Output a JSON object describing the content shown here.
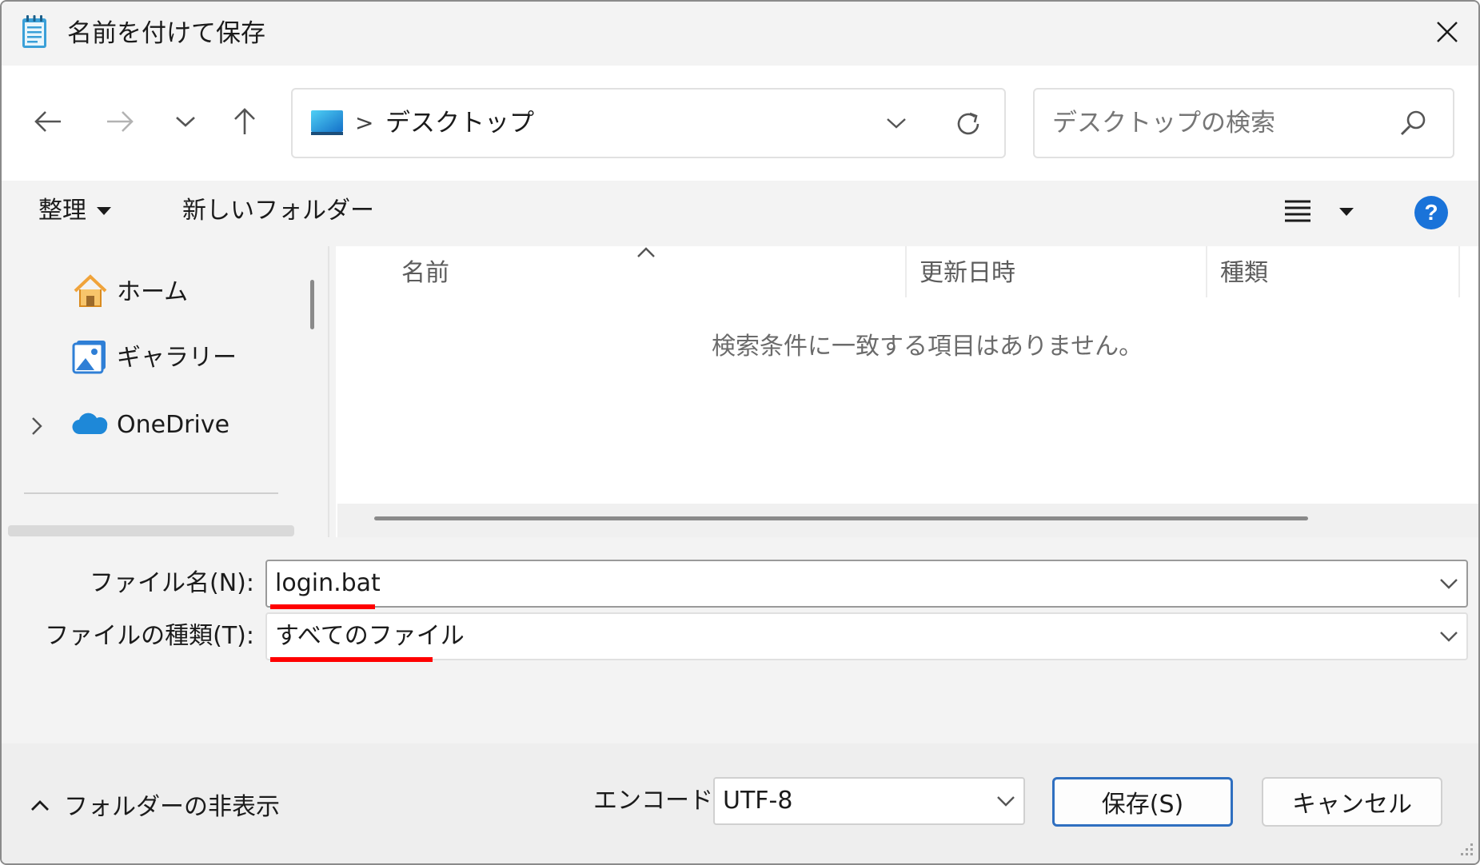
{
  "window": {
    "title": "名前を付けて保存"
  },
  "icons": {
    "app": "notepad-icon",
    "close": "close-icon",
    "back": "back-arrow-icon",
    "forward": "forward-arrow-icon",
    "recent": "chevron-down-icon",
    "up": "up-arrow-icon",
    "desktop": "desktop-icon",
    "refresh": "refresh-icon",
    "search": "search-icon",
    "view": "view-list-icon",
    "help": "help-icon"
  },
  "address": {
    "separator": ">",
    "location": "デスクトップ"
  },
  "search": {
    "placeholder": "デスクトップの検索"
  },
  "toolbar": {
    "organize": "整理",
    "new_folder": "新しいフォルダー"
  },
  "sidebar": {
    "items": [
      {
        "label": "ホーム",
        "icon": "home-icon"
      },
      {
        "label": "ギャラリー",
        "icon": "gallery-icon"
      },
      {
        "label": "OneDrive",
        "icon": "onedrive-cloud-icon"
      }
    ]
  },
  "file_list": {
    "columns": [
      "名前",
      "更新日時",
      "種類"
    ],
    "sort_indicator": "^",
    "empty_message": "検索条件に一致する項目はありません。"
  },
  "form": {
    "filename_label": "ファイル名(N):",
    "filename_value": "login.bat",
    "filetype_label": "ファイルの種類(T):",
    "filetype_value": "すべてのファイル"
  },
  "footer": {
    "hide_folders": "フォルダーの非表示",
    "encoding_label": "エンコード:",
    "encoding_value": "UTF-8",
    "save_button": "保存(S)",
    "cancel_button": "キャンセル"
  },
  "colors": {
    "accent": "#2f6fc0",
    "highlight_underline": "#ff0000",
    "help": "#1a73d9",
    "home_orange": "#f0a33a",
    "onedrive_blue": "#1e88d8"
  }
}
